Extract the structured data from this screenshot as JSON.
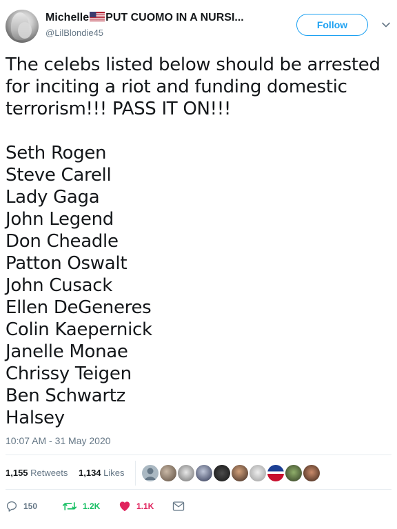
{
  "user": {
    "name_prefix": "Michelle",
    "name_suffix": "PUT CUOMO IN A NURSI...",
    "handle": "@LilBlondie45"
  },
  "follow_label": "Follow",
  "tweet_text": "The celebs listed below should be arrested for inciting a riot and funding domestic terrorism!!! PASS IT ON!!!\n\nSeth Rogen\nSteve Carell\nLady Gaga\nJohn Legend\nDon Cheadle\nPatton Oswalt\nJohn Cusack\nEllen DeGeneres\nColin Kaepernick\nJanelle Monae\nChrissy Teigen\nBen Schwartz\nHalsey",
  "timestamp": "10:07 AM - 31 May 2020",
  "stats": {
    "retweets_count": "1,155",
    "retweets_label": "Retweets",
    "likes_count": "1,134",
    "likes_label": "Likes"
  },
  "actions": {
    "replies": "150",
    "retweets": "1.2K",
    "likes": "1.1K"
  },
  "colors": {
    "accent": "#1da1f2",
    "retweet": "#17bf63",
    "like": "#e0245e",
    "muted": "#657786"
  },
  "icons": {
    "chevron": "chevron-down-icon",
    "reply": "reply-icon",
    "retweet": "retweet-icon",
    "like": "heart-icon",
    "dm": "envelope-icon"
  }
}
